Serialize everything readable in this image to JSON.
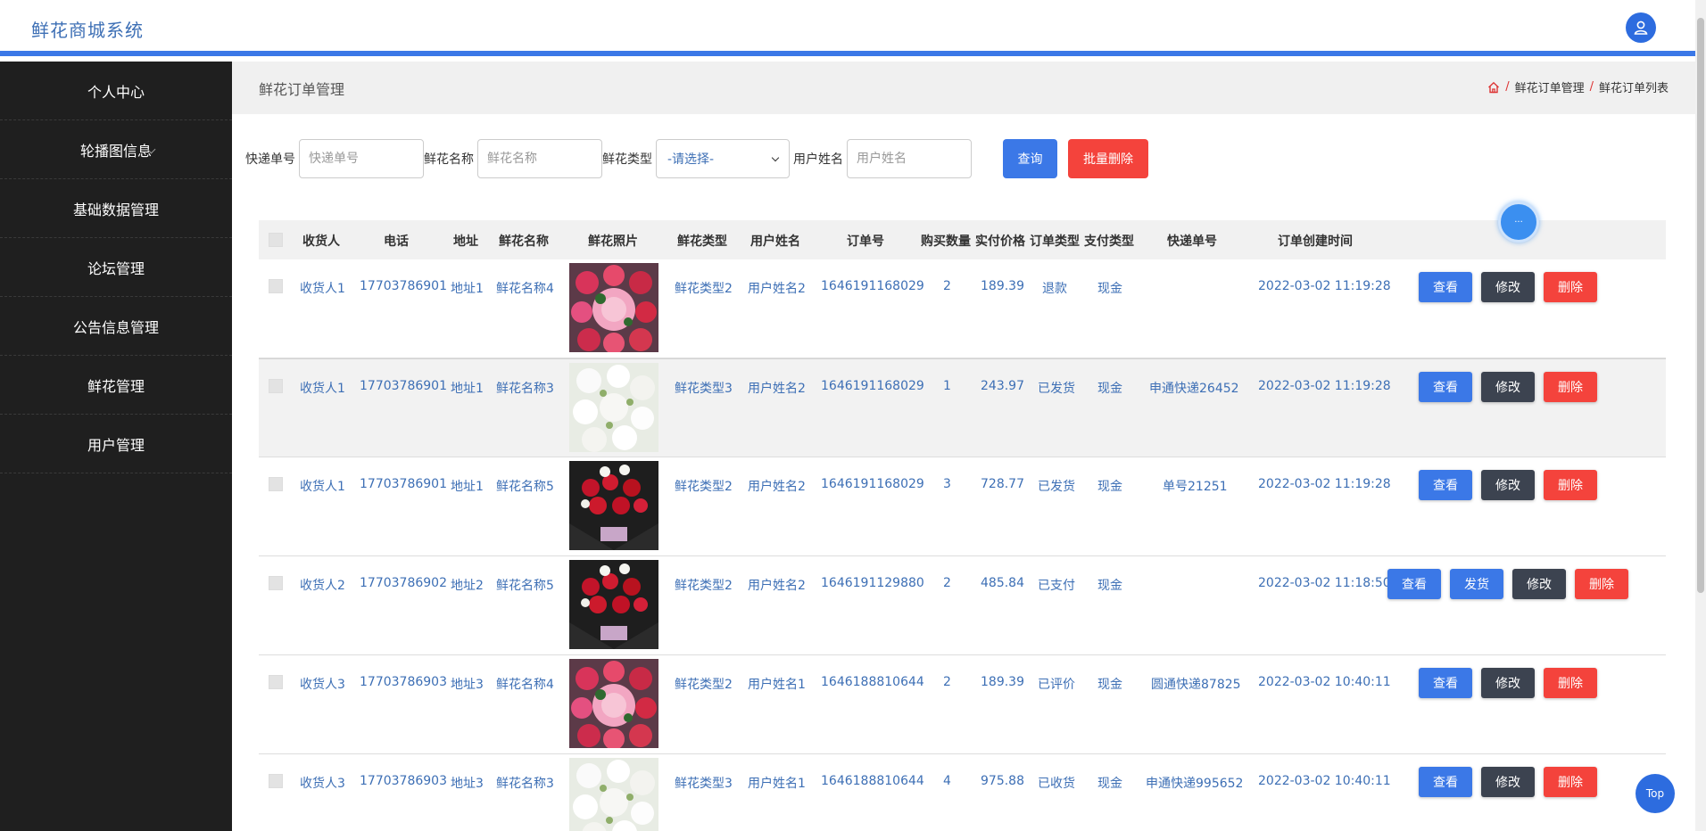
{
  "header": {
    "title": "鲜花商城系统"
  },
  "sidebar": {
    "items": [
      {
        "label": "个人中心"
      },
      {
        "label": "轮播图信息"
      },
      {
        "label": "基础数据管理"
      },
      {
        "label": "论坛管理"
      },
      {
        "label": "公告信息管理"
      },
      {
        "label": "鲜花管理"
      },
      {
        "label": "用户管理"
      }
    ]
  },
  "page": {
    "title": "鲜花订单管理",
    "breadcrumb": [
      "鲜花订单管理",
      "鲜花订单列表"
    ]
  },
  "filters": {
    "express": {
      "label": "快递单号",
      "placeholder": "快递单号"
    },
    "flower_name": {
      "label": "鲜花名称",
      "placeholder": "鲜花名称"
    },
    "flower_type": {
      "label": "鲜花类型",
      "value": "-请选择-"
    },
    "user_name": {
      "label": "用户姓名",
      "placeholder": "用户姓名"
    },
    "query_label": "查询",
    "batch_delete_label": "批量删除"
  },
  "table": {
    "columns": [
      "收货人",
      "电话",
      "地址",
      "鲜花名称",
      "鲜花照片",
      "鲜花类型",
      "用户姓名",
      "订单号",
      "购买数量",
      "实付价格",
      "订单类型",
      "支付类型",
      "快递单号",
      "订单创建时间"
    ],
    "rows": [
      {
        "receiver": "收货人1",
        "phone": "17703786901",
        "address": "地址1",
        "flower": "鲜花名称4",
        "type": "鲜花类型2",
        "user": "用户姓名2",
        "order": "1646191168029",
        "qty": "2",
        "price": "189.39",
        "status": "退款",
        "pay": "现金",
        "express": "",
        "created": "2022-03-02 11:19:28",
        "photo": "pink"
      },
      {
        "receiver": "收货人1",
        "phone": "17703786901",
        "address": "地址1",
        "flower": "鲜花名称3",
        "type": "鲜花类型3",
        "user": "用户姓名2",
        "order": "1646191168029",
        "qty": "1",
        "price": "243.97",
        "status": "已发货",
        "pay": "现金",
        "express": "申通快递26452",
        "created": "2022-03-02 11:19:28",
        "photo": "white"
      },
      {
        "receiver": "收货人1",
        "phone": "17703786901",
        "address": "地址1",
        "flower": "鲜花名称5",
        "type": "鲜花类型2",
        "user": "用户姓名2",
        "order": "1646191168029",
        "qty": "3",
        "price": "728.77",
        "status": "已发货",
        "pay": "现金",
        "express": "单号21251",
        "created": "2022-03-02 11:19:28",
        "photo": "dark"
      },
      {
        "receiver": "收货人2",
        "phone": "17703786902",
        "address": "地址2",
        "flower": "鲜花名称5",
        "type": "鲜花类型2",
        "user": "用户姓名2",
        "order": "1646191129880",
        "qty": "2",
        "price": "485.84",
        "status": "已支付",
        "pay": "现金",
        "express": "",
        "created": "2022-03-02 11:18:50",
        "photo": "dark"
      },
      {
        "receiver": "收货人3",
        "phone": "17703786903",
        "address": "地址3",
        "flower": "鲜花名称4",
        "type": "鲜花类型2",
        "user": "用户姓名1",
        "order": "1646188810644",
        "qty": "2",
        "price": "189.39",
        "status": "已评价",
        "pay": "现金",
        "express": "圆通快递87825",
        "created": "2022-03-02 10:40:11",
        "photo": "pink"
      },
      {
        "receiver": "收货人3",
        "phone": "17703786903",
        "address": "地址3",
        "flower": "鲜花名称3",
        "type": "鲜花类型3",
        "user": "用户姓名1",
        "order": "1646188810644",
        "qty": "4",
        "price": "975.88",
        "status": "已收货",
        "pay": "现金",
        "express": "申通快递995652",
        "created": "2022-03-02 10:40:11",
        "photo": "white"
      }
    ],
    "actions": {
      "view": "查看",
      "edit": "修改",
      "delete": "删除",
      "ship": "发货"
    }
  },
  "floating": {
    "top_label": "Top"
  },
  "colors": {
    "accent": "#3b78e7",
    "danger": "#f4433c",
    "dark": "#3c4350",
    "sidebar": "#1f1f1f"
  }
}
